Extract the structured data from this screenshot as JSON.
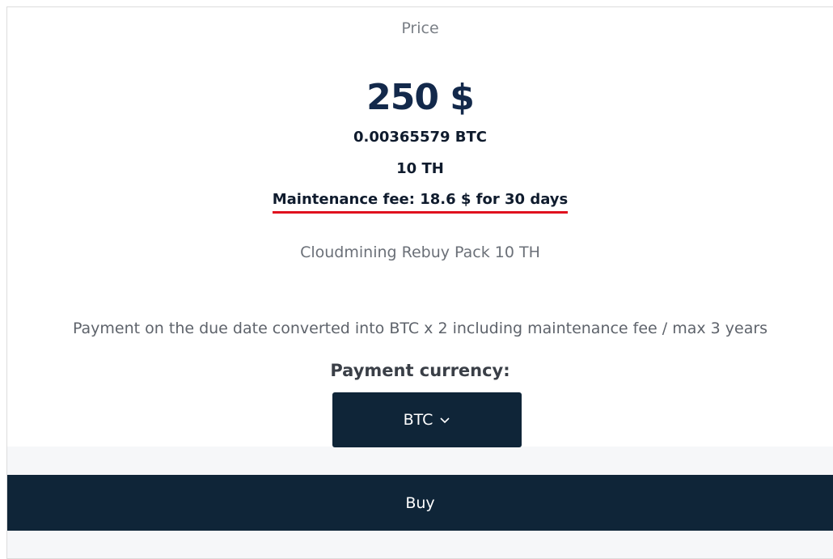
{
  "price": {
    "label": "Price",
    "usd": "250 $",
    "btc": "0.00365579 BTC",
    "hashrate": "10 TH",
    "maintenance_fee": "Maintenance fee: 18.6 $ for 30 days"
  },
  "product": {
    "name": "Cloudmining Rebuy Pack 10 TH"
  },
  "payment": {
    "note": "Payment on the due date converted into BTC x 2 including maintenance fee / max 3 years",
    "currency_label": "Payment currency:",
    "currency_value": "BTC"
  },
  "actions": {
    "buy_label": "Buy"
  },
  "colors": {
    "accent_dark": "#0f2538",
    "price_blue": "#13294b",
    "highlight_red": "#e0101e"
  }
}
